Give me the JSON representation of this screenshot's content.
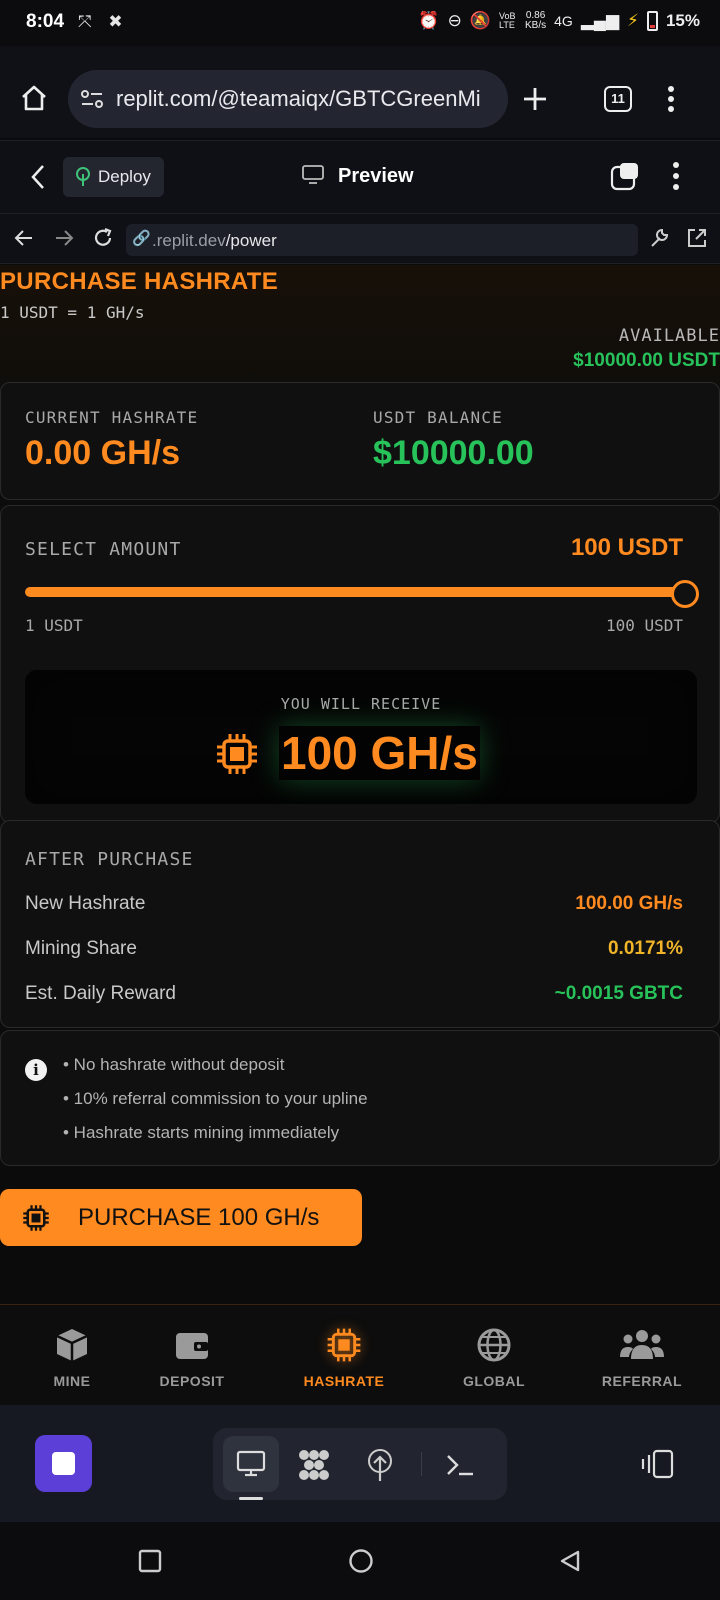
{
  "status_bar": {
    "time": "8:04",
    "net_speed": "0.86",
    "net_speed_unit": "KB/s",
    "network": "4G",
    "volte": "VoB LTE",
    "battery": "15%"
  },
  "browser": {
    "url": "replit.com/@teamaiqx/GBTCGreenMi",
    "tab_count": "11"
  },
  "replit_header": {
    "deploy_label": "Deploy",
    "preview_label": "Preview"
  },
  "webview": {
    "url_host": ".replit.dev",
    "url_path": "/power"
  },
  "page": {
    "title": "PURCHASE HASHRATE",
    "rate": "1 USDT = 1 GH/s",
    "available_label": "AVAILABLE",
    "available_value": "$10000.00 USDT"
  },
  "stats": {
    "hashrate_label": "CURRENT HASHRATE",
    "hashrate_value": "0.00 GH/s",
    "balance_label": "USDT BALANCE",
    "balance_value": "$10000.00"
  },
  "amount": {
    "label": "SELECT AMOUNT",
    "value": "100 USDT",
    "min_label": "1 USDT",
    "max_label": "100 USDT",
    "slider_fraction": 1.0,
    "receive_label": "YOU WILL RECEIVE",
    "receive_value": "100 GH/s"
  },
  "after": {
    "title": "AFTER PURCHASE",
    "rows": [
      {
        "label": "New Hashrate",
        "value": "100.00 GH/s",
        "color": "#ff8a1f"
      },
      {
        "label": "Mining Share",
        "value": "0.0171%",
        "color": "#f0b429"
      },
      {
        "label": "Est. Daily Reward",
        "value": "~0.0015 GBTC",
        "color": "#27c25a"
      }
    ]
  },
  "info": {
    "bullets": [
      "• No hashrate without deposit",
      "• 10% referral commission to your upline",
      "• Hashrate starts mining immediately"
    ]
  },
  "purchase_button": "PURCHASE 100 GH/s",
  "nav": {
    "items": [
      {
        "label": "MINE",
        "icon": "cube-icon"
      },
      {
        "label": "DEPOSIT",
        "icon": "wallet-icon"
      },
      {
        "label": "HASHRATE",
        "icon": "chip-icon",
        "active": true
      },
      {
        "label": "GLOBAL",
        "icon": "globe-icon"
      },
      {
        "label": "REFERRAL",
        "icon": "users-icon"
      }
    ]
  },
  "colors": {
    "accent": "#ff8a1f",
    "green": "#27c25a",
    "yellow": "#f0b429"
  }
}
